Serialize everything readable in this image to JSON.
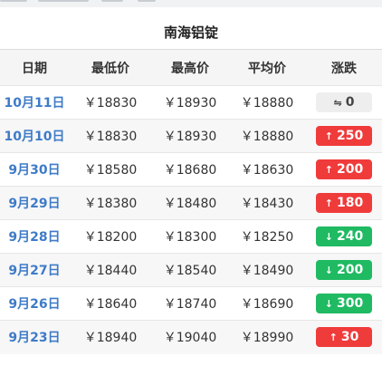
{
  "title": "南海铝锭",
  "table": {
    "headers": [
      "日期",
      "最低价",
      "最高价",
      "平均价",
      "涨跌"
    ],
    "rows": [
      {
        "date": "10月11日",
        "low": "￥18830",
        "high": "￥18930",
        "avg": "￥18880",
        "change": "0",
        "dir": "flat",
        "arrow": "⇋"
      },
      {
        "date": "10月10日",
        "low": "￥18830",
        "high": "￥18930",
        "avg": "￥18880",
        "change": "250",
        "dir": "up",
        "arrow": "↑"
      },
      {
        "date": "9月30日",
        "low": "￥18580",
        "high": "￥18680",
        "avg": "￥18630",
        "change": "200",
        "dir": "up",
        "arrow": "↑"
      },
      {
        "date": "9月29日",
        "low": "￥18380",
        "high": "￥18480",
        "avg": "￥18430",
        "change": "180",
        "dir": "up",
        "arrow": "↑"
      },
      {
        "date": "9月28日",
        "low": "￥18200",
        "high": "￥18300",
        "avg": "￥18250",
        "change": "240",
        "dir": "down",
        "arrow": "↓"
      },
      {
        "date": "9月27日",
        "low": "￥18440",
        "high": "￥18540",
        "avg": "￥18490",
        "change": "200",
        "dir": "down",
        "arrow": "↓"
      },
      {
        "date": "9月26日",
        "low": "￥18640",
        "high": "￥18740",
        "avg": "￥18690",
        "change": "300",
        "dir": "down",
        "arrow": "↓"
      },
      {
        "date": "9月23日",
        "low": "￥18940",
        "high": "￥19040",
        "avg": "￥18990",
        "change": "30",
        "dir": "up",
        "arrow": "↑"
      }
    ]
  },
  "colors": {
    "up": "#f03b3b",
    "down": "#1fba62",
    "flat": "#eeeeee",
    "date_link": "#3e7bc7"
  }
}
